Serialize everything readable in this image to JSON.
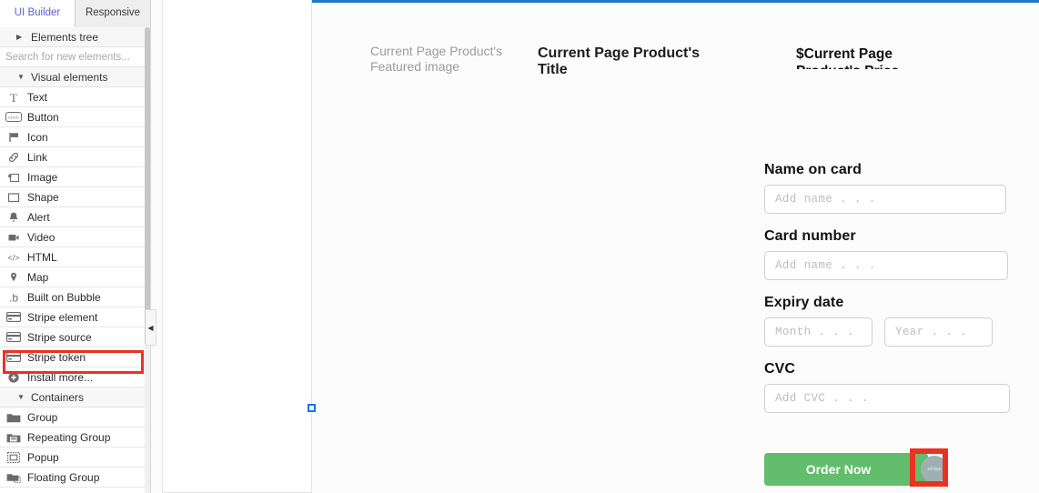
{
  "left_panel": {
    "tabs": [
      {
        "label": "UI Builder",
        "active": true
      },
      {
        "label": "Responsive",
        "active": false
      }
    ],
    "elements_tree": {
      "label": "Elements tree"
    },
    "search": {
      "placeholder": "Search for new elements...",
      "value": ""
    },
    "sections": [
      {
        "title": "Visual elements",
        "expanded": true,
        "items": [
          {
            "label": "Text",
            "icon": "text-serif-icon"
          },
          {
            "label": "Button",
            "icon": "button-click-icon"
          },
          {
            "label": "Icon",
            "icon": "flag-icon"
          },
          {
            "label": "Link",
            "icon": "link-chain-icon"
          },
          {
            "label": "Image",
            "icon": "image-icon"
          },
          {
            "label": "Shape",
            "icon": "square-outline-icon"
          },
          {
            "label": "Alert",
            "icon": "bell-icon"
          },
          {
            "label": "Video",
            "icon": "video-camera-icon"
          },
          {
            "label": "HTML",
            "icon": "code-brackets-icon"
          },
          {
            "label": "Map",
            "icon": "map-pin-icon"
          },
          {
            "label": "Built on Bubble",
            "icon": "bubble-b-icon"
          },
          {
            "label": "Stripe element",
            "icon": "credit-card-icon"
          },
          {
            "label": "Stripe source",
            "icon": "credit-card-icon"
          },
          {
            "label": "Stripe token",
            "icon": "credit-card-icon",
            "highlighted": true
          },
          {
            "label": "Install more...",
            "icon": "plus-circle-icon"
          }
        ]
      },
      {
        "title": "Containers",
        "expanded": true,
        "items": [
          {
            "label": "Group",
            "icon": "folder-icon"
          },
          {
            "label": "Repeating Group",
            "icon": "folder-repeat-icon"
          },
          {
            "label": "Popup",
            "icon": "popup-icon"
          },
          {
            "label": "Floating Group",
            "icon": "folder-floating-icon"
          }
        ]
      }
    ],
    "collapse_handle": {
      "glyph": "◀"
    }
  },
  "canvas": {
    "featured_image_label": "Current Page Product's Featured image",
    "product_title": "Current Page Product's Title",
    "product_price": "$Current Page Product's Price",
    "form": {
      "fields": [
        {
          "label": "Name on card",
          "placeholder": "Add  name . . .",
          "value": ""
        },
        {
          "label": "Card number",
          "placeholder": "Add  name . . .",
          "value": ""
        }
      ],
      "expiry": {
        "label": "Expiry date",
        "month_placeholder": "Month . . .",
        "year_placeholder": "Year . . ."
      },
      "cvc": {
        "label": "CVC",
        "placeholder": "Add  CVC . . ."
      }
    },
    "order_button": {
      "label": "Order Now",
      "color": "#62bd6d"
    },
    "stripe_token_element": {
      "label": "stripe"
    }
  },
  "colors": {
    "accent_blue": "#1b78c4",
    "highlight_red": "#ea3223",
    "tab_active_text": "#5c5cd6",
    "button_green": "#62bd6d",
    "marker_blue": "#1a73e8"
  }
}
